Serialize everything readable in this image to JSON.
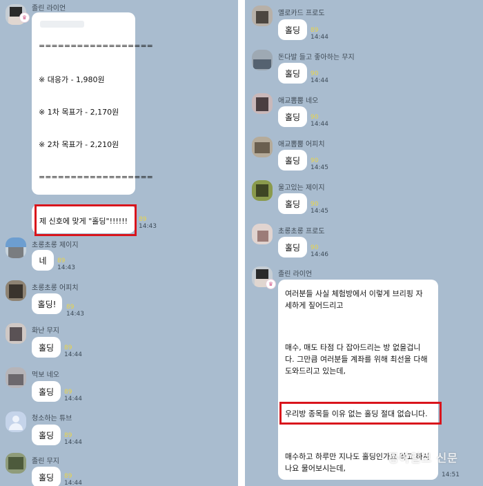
{
  "left_panel": {
    "top_message": {
      "sender": "졸린 라이언",
      "lines": [
        "==================",
        "※ 대응가 - 1,980원",
        "※ 1차 목표가 - 2,170원",
        "※ 2차 목표가 - 2,210원",
        "=================="
      ],
      "highlight": "제 신호에 맞게 \"홀딩\"!!!!!!",
      "count": "89",
      "time": "14:43"
    },
    "messages": [
      {
        "sender": "초롱초롱 제이지",
        "text": "네",
        "count": "89",
        "time": "14:43"
      },
      {
        "sender": "초롱초롱 어피치",
        "text": "홀딩!",
        "count": "89",
        "time": "14:43"
      },
      {
        "sender": "화난 무지",
        "text": "홀딩",
        "count": "89",
        "time": "14:44"
      },
      {
        "sender": "먹보 네오",
        "text": "홀딩",
        "count": "89",
        "time": "14:44"
      },
      {
        "sender": "청소하는 튜브",
        "text": "홀딩",
        "count": "89",
        "time": "14:44"
      },
      {
        "sender": "졸린 무지",
        "text": "홀딩",
        "count": "89",
        "time": "14:44"
      }
    ]
  },
  "right_panel": {
    "messages": [
      {
        "sender": "옐로카드 프로도",
        "text": "홀딩",
        "count": "89",
        "time": "14:44"
      },
      {
        "sender": "돈다발 들고 좋아하는 무지",
        "text": "홀딩",
        "count": "90",
        "time": "14:44"
      },
      {
        "sender": "애교뽐뿜 네오",
        "text": "홀딩",
        "count": "90",
        "time": "14:44"
      },
      {
        "sender": "애교뽐뿜 어피치",
        "text": "홀딩",
        "count": "90",
        "time": "14:45"
      },
      {
        "sender": "울고있는 제이지",
        "text": "홀딩",
        "count": "90",
        "time": "14:45"
      },
      {
        "sender": "초롱초롱 프로도",
        "text": "홀딩",
        "count": "90",
        "time": "14:46"
      }
    ],
    "long_message": {
      "sender": "졸린 라이언",
      "para1": [
        "여러분들 사실 체험방에서 이렇게 브리핑 자",
        "세하게 짚어드리고"
      ],
      "para2": [
        "매수, 매도 타점 다 잡아드리는 방 없을겁니",
        "다. 그만큼 여러분들 계좌를 위해 최선을 다해",
        "도와드리고 있는데,"
      ],
      "highlight": "우리방 종목들 이유 없는 홀딩 절대 없습니다.",
      "para3": [
        "매수하고 하루만 지나도 홀딩인가요 라고 하시",
        "나요 물어보시는데,"
      ],
      "time": "14:51"
    }
  },
  "watermark": "동아일보 신문",
  "colors": {
    "chat_bg": "#a9bccf",
    "highlight_border": "#d9141c",
    "read_count": "#e9d44a"
  }
}
